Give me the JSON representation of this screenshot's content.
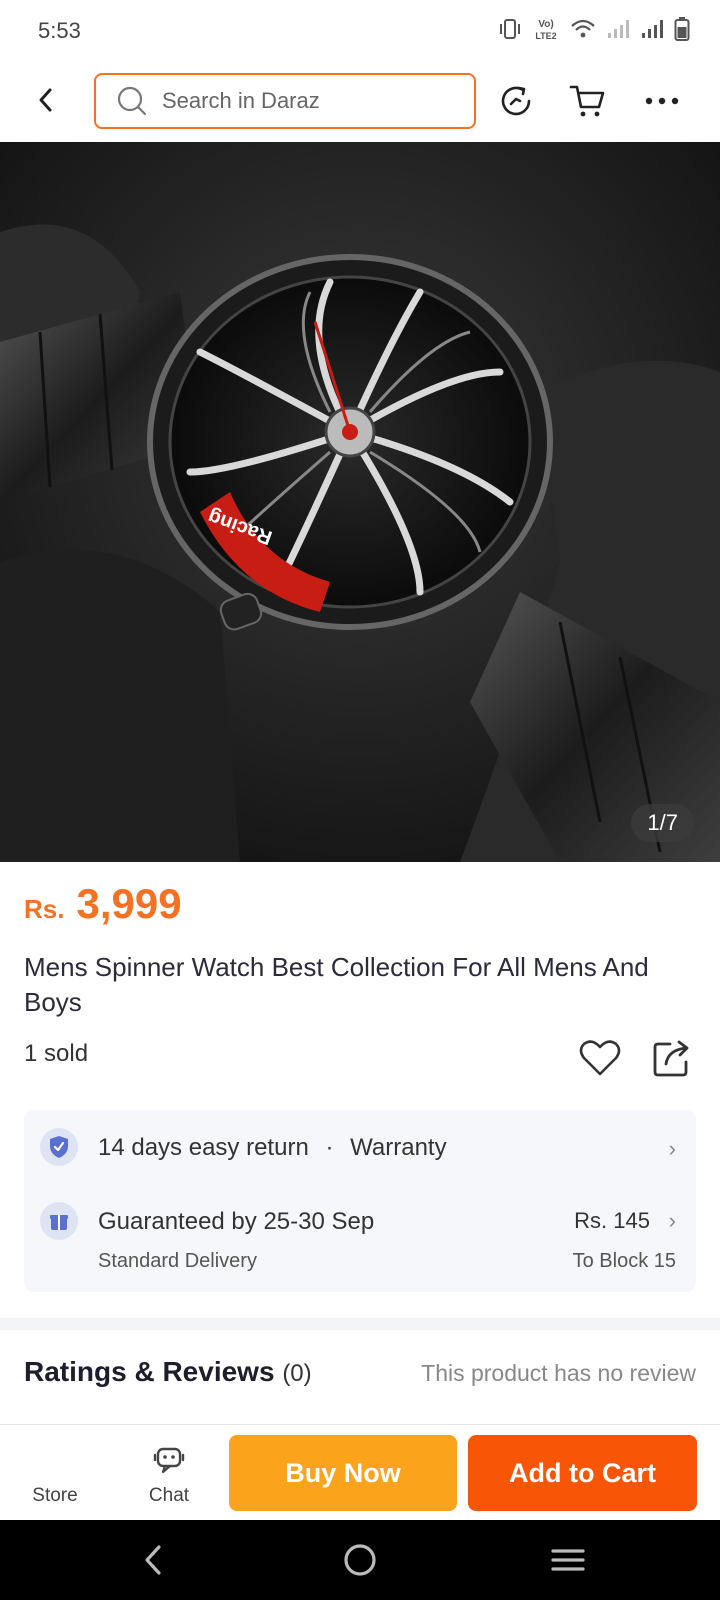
{
  "status_bar": {
    "time": "5:53",
    "network_label": "Vo) LTE2"
  },
  "header": {
    "search": {
      "placeholder": "Search in Daraz",
      "value": ""
    }
  },
  "product": {
    "image_counter": "1/7",
    "price_currency": "Rs.",
    "price_value": "3,999",
    "title": "Mens Spinner Watch Best Collection For All Mens And Boys",
    "sold": "1 sold",
    "accent_color": "#f57224"
  },
  "services": {
    "return": {
      "text": "14 days easy return",
      "separator": "·",
      "warranty": "Warranty"
    },
    "delivery": {
      "text": "Guaranteed by 25-30 Sep",
      "sub": "Standard Delivery",
      "fee": "Rs. 145",
      "destination": "To Block 15"
    }
  },
  "ratings": {
    "title": "Ratings & Reviews",
    "count": "(0)",
    "empty_text": "This product has no review"
  },
  "action_bar": {
    "store_label": "Store",
    "chat_label": "Chat",
    "buy_now_label": "Buy Now",
    "add_to_cart_label": "Add to Cart",
    "buy_color": "#faa31b",
    "cart_color": "#f85606"
  },
  "icons": [
    "back-arrow-icon",
    "search-icon",
    "history-icon",
    "cart-icon",
    "more-icon",
    "heart-icon",
    "share-icon",
    "shield-check-icon",
    "gift-icon",
    "store-icon",
    "chat-bot-icon"
  ]
}
